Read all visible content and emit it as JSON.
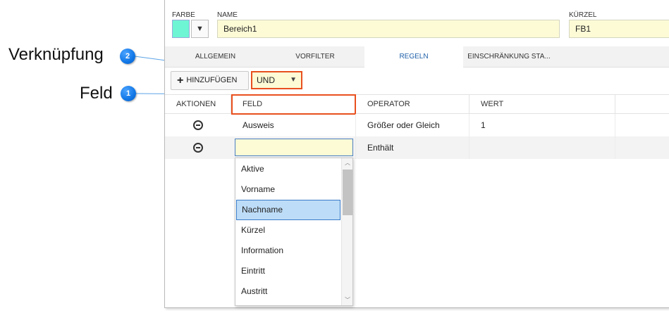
{
  "annotations": {
    "verknuepfung": {
      "label": "Verknüpfung",
      "number": "2"
    },
    "feld": {
      "label": "Feld",
      "number": "1"
    }
  },
  "header": {
    "farbe_label": "FARBE",
    "farbe_color": "#6ef5d3",
    "name_label": "NAME",
    "name_value": "Bereich1",
    "kuerzel_label": "KÜRZEL",
    "kuerzel_value": "FB1"
  },
  "tabs": [
    {
      "label": "ALLGEMEIN",
      "active": false
    },
    {
      "label": "VORFILTER",
      "active": false
    },
    {
      "label": "REGELN",
      "active": true
    },
    {
      "label": "EINSCHRÄNKUNG STA...",
      "active": false
    }
  ],
  "toolbar": {
    "add_label": "HINZUFÜGEN",
    "verknuepfung_value": "UND"
  },
  "table": {
    "columns": [
      "AKTIONEN",
      "FELD",
      "OPERATOR",
      "WERT"
    ],
    "rows": [
      {
        "feld": "Ausweis",
        "operator": "Größer oder Gleich",
        "wert": "1"
      },
      {
        "feld": "",
        "operator": "Enthält",
        "wert": ""
      }
    ]
  },
  "dropdown": {
    "options": [
      "Aktive",
      "Vorname",
      "Nachname",
      "Kürzel",
      "Information",
      "Eintritt",
      "Austritt"
    ],
    "selected": "Nachname"
  },
  "colors": {
    "highlight_border": "#e8501f",
    "field_background": "#fdfbd6",
    "active_tab_text": "#1e5fa8",
    "badge": "#1177e6"
  }
}
